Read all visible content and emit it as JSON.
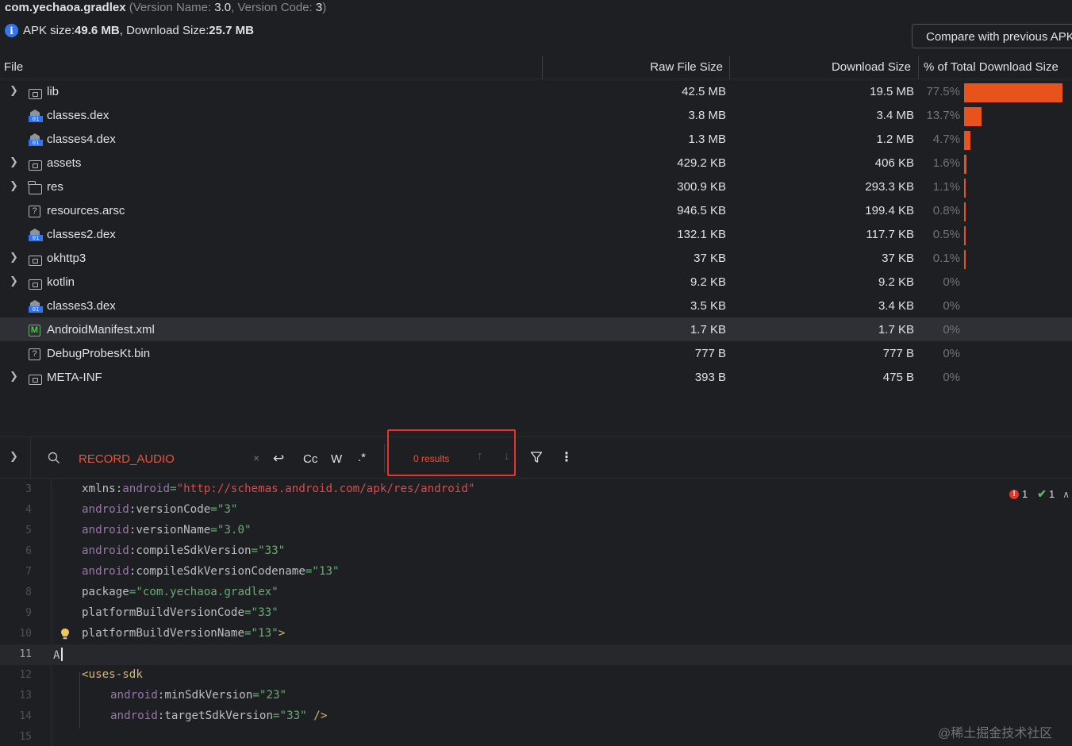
{
  "header": {
    "package_name": "com.yechaoa.gradlex",
    "version_prefix": "(Version Name: ",
    "version_name": "3.0",
    "version_mid": ", Version Code: ",
    "version_code": "3",
    "version_suffix": ")",
    "apk_size_label": "APK size: ",
    "apk_size": "49.6 MB",
    "download_size_label": ", Download Size: ",
    "download_size": "25.7 MB",
    "info_icon": "i",
    "compare_button": "Compare with previous APK..."
  },
  "table": {
    "columns": {
      "file": "File",
      "raw": "Raw File Size",
      "download": "Download Size",
      "percent": "% of Total Download Size"
    },
    "rows": [
      {
        "name": "lib",
        "icon": "folder-icon",
        "expandable": true,
        "raw": "42.5 MB",
        "download": "19.5 MB",
        "percent": "77.5%",
        "share": 0.775
      },
      {
        "name": "classes.dex",
        "icon": "dex-icon",
        "expandable": false,
        "raw": "3.8 MB",
        "download": "3.4 MB",
        "percent": "13.7%",
        "share": 0.137
      },
      {
        "name": "classes4.dex",
        "icon": "dex-icon",
        "expandable": false,
        "raw": "1.3 MB",
        "download": "1.2 MB",
        "percent": "4.7%",
        "share": 0.047
      },
      {
        "name": "assets",
        "icon": "folder-icon",
        "expandable": true,
        "raw": "429.2 KB",
        "download": "406 KB",
        "percent": "1.6%",
        "share": 0.016
      },
      {
        "name": "res",
        "icon": "resource-folder-icon",
        "expandable": true,
        "raw": "300.9 KB",
        "download": "293.3 KB",
        "percent": "1.1%",
        "share": 0.011
      },
      {
        "name": "resources.arsc",
        "icon": "unknown-file-icon",
        "expandable": false,
        "raw": "946.5 KB",
        "download": "199.4 KB",
        "percent": "0.8%",
        "share": 0.008
      },
      {
        "name": "classes2.dex",
        "icon": "dex-icon",
        "expandable": false,
        "raw": "132.1 KB",
        "download": "117.7 KB",
        "percent": "0.5%",
        "share": 0.005
      },
      {
        "name": "okhttp3",
        "icon": "folder-icon",
        "expandable": true,
        "raw": "37 KB",
        "download": "37 KB",
        "percent": "0.1%",
        "share": 0.001
      },
      {
        "name": "kotlin",
        "icon": "folder-icon",
        "expandable": true,
        "raw": "9.2 KB",
        "download": "9.2 KB",
        "percent": "0%",
        "share": 0
      },
      {
        "name": "classes3.dex",
        "icon": "dex-icon",
        "expandable": false,
        "raw": "3.5 KB",
        "download": "3.4 KB",
        "percent": "0%",
        "share": 0
      },
      {
        "name": "AndroidManifest.xml",
        "icon": "manifest-icon",
        "expandable": false,
        "raw": "1.7 KB",
        "download": "1.7 KB",
        "percent": "0%",
        "share": 0,
        "selected": true
      },
      {
        "name": "DebugProbesKt.bin",
        "icon": "unknown-file-icon",
        "expandable": false,
        "raw": "777 B",
        "download": "777 B",
        "percent": "0%",
        "share": 0
      },
      {
        "name": "META-INF",
        "icon": "folder-icon",
        "expandable": true,
        "raw": "393 B",
        "download": "475 B",
        "percent": "0%",
        "share": 0
      }
    ]
  },
  "search": {
    "query": "RECORD_AUDIO",
    "clear": "×",
    "match_case": "Cc",
    "words": "W",
    "regex": ".*",
    "results": "0 results"
  },
  "inspections": {
    "errors": "1",
    "ok": "1"
  },
  "editor": {
    "lines": [
      {
        "n": "3",
        "tokens": [
          [
            "ns",
            "xmlns:"
          ],
          [
            "attr",
            "android"
          ],
          [
            "str",
            "="
          ],
          [
            "url",
            "\"http://schemas.android.com/apk/res/android\""
          ]
        ]
      },
      {
        "n": "4",
        "tokens": [
          [
            "attr",
            "android"
          ],
          [
            "ns",
            ":versionCode"
          ],
          [
            "str",
            "=\"3\""
          ]
        ]
      },
      {
        "n": "5",
        "tokens": [
          [
            "attr",
            "android"
          ],
          [
            "ns",
            ":versionName"
          ],
          [
            "str",
            "=\"3.0\""
          ]
        ]
      },
      {
        "n": "6",
        "tokens": [
          [
            "attr",
            "android"
          ],
          [
            "ns",
            ":compileSdkVersion"
          ],
          [
            "str",
            "=\"33\""
          ]
        ]
      },
      {
        "n": "7",
        "tokens": [
          [
            "attr",
            "android"
          ],
          [
            "ns",
            ":compileSdkVersionCodename"
          ],
          [
            "str",
            "=\"13\""
          ]
        ]
      },
      {
        "n": "8",
        "tokens": [
          [
            "ns",
            "package"
          ],
          [
            "str",
            "=\"com.yechaoa.gradlex\""
          ]
        ]
      },
      {
        "n": "9",
        "tokens": [
          [
            "ns",
            "platformBuildVersionCode"
          ],
          [
            "str",
            "=\"33\""
          ]
        ]
      },
      {
        "n": "10",
        "tokens": [
          [
            "ns",
            "platformBuildVersionName"
          ],
          [
            "str",
            "=\"13\""
          ],
          [
            "brk",
            ">"
          ]
        ],
        "bulb": true
      },
      {
        "n": "11",
        "tokens": [
          [
            "ns",
            "A"
          ]
        ],
        "current": true
      },
      {
        "n": "12",
        "tokens": [
          [
            "tag",
            "<uses-sdk"
          ]
        ]
      },
      {
        "n": "13",
        "tokens": [
          [
            "attr",
            "android"
          ],
          [
            "ns",
            ":minSdkVersion"
          ],
          [
            "str",
            "=\"23\""
          ]
        ],
        "indent": 2
      },
      {
        "n": "14",
        "tokens": [
          [
            "attr",
            "android"
          ],
          [
            "ns",
            ":targetSdkVersion"
          ],
          [
            "str",
            "=\"33\""
          ],
          [
            "brk",
            " />"
          ]
        ],
        "indent": 2
      },
      {
        "n": "15",
        "tokens": []
      }
    ]
  },
  "watermark": "@稀土掘金技术社区"
}
